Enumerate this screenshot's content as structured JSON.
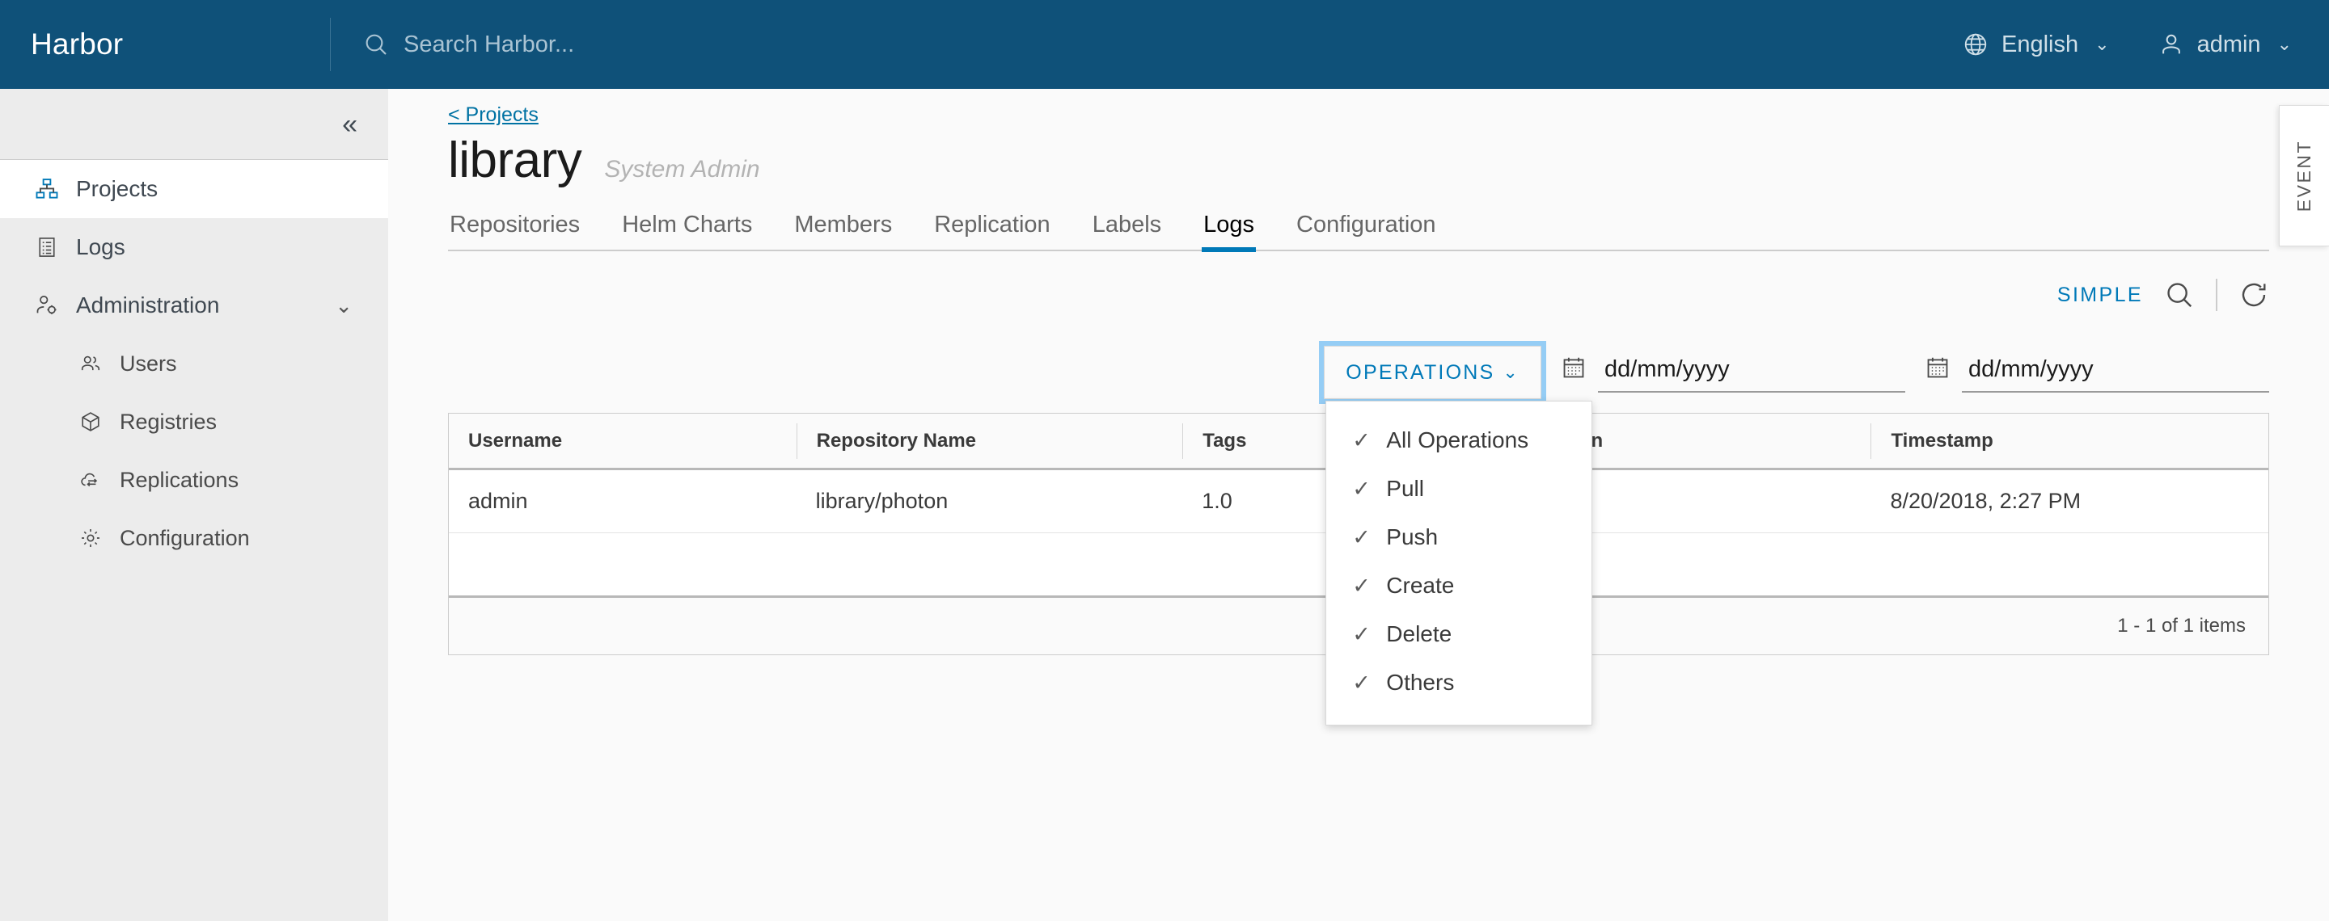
{
  "header": {
    "brand": "Harbor",
    "search_placeholder": "Search Harbor...",
    "language": "English",
    "user": "admin"
  },
  "sidebar": {
    "collapse_label": "«",
    "items": [
      {
        "label": "Projects",
        "icon": "org-chart-icon",
        "active": true
      },
      {
        "label": "Logs",
        "icon": "list-document-icon",
        "active": false
      },
      {
        "label": "Administration",
        "icon": "user-gear-icon",
        "active": false,
        "expandable": true
      }
    ],
    "sub_items": [
      {
        "label": "Users",
        "icon": "users-icon"
      },
      {
        "label": "Registries",
        "icon": "cube-icon"
      },
      {
        "label": "Replications",
        "icon": "cloud-sync-icon"
      },
      {
        "label": "Configuration",
        "icon": "gear-icon"
      }
    ]
  },
  "page": {
    "breadcrumb": "< Projects",
    "title": "library",
    "role": "System Admin",
    "tabs": [
      {
        "label": "Repositories",
        "active": false
      },
      {
        "label": "Helm Charts",
        "active": false
      },
      {
        "label": "Members",
        "active": false
      },
      {
        "label": "Replication",
        "active": false
      },
      {
        "label": "Labels",
        "active": false
      },
      {
        "label": "Logs",
        "active": true
      },
      {
        "label": "Configuration",
        "active": false
      }
    ]
  },
  "toolbar": {
    "simple_label": "SIMPLE",
    "search_icon": "search-icon",
    "refresh_icon": "refresh-icon"
  },
  "filters": {
    "operations_label": "OPERATIONS",
    "date_from_placeholder": "dd/mm/yyyy",
    "date_from_value": "",
    "date_to_placeholder": "dd/mm/yyyy",
    "date_to_value": "",
    "dropdown_open": true,
    "dropdown_items": [
      {
        "label": "All Operations",
        "checked": true
      },
      {
        "label": "Pull",
        "checked": true
      },
      {
        "label": "Push",
        "checked": true
      },
      {
        "label": "Create",
        "checked": true
      },
      {
        "label": "Delete",
        "checked": true
      },
      {
        "label": "Others",
        "checked": true
      }
    ]
  },
  "table": {
    "columns": [
      "Username",
      "Repository Name",
      "Tags",
      "Operation",
      "Timestamp"
    ],
    "rows": [
      {
        "username": "admin",
        "repository_name": "library/photon",
        "tags": "1.0",
        "operation": "",
        "timestamp": "8/20/2018, 2:27 PM"
      }
    ],
    "pagination": "1 - 1 of 1 items"
  },
  "side_panel": {
    "event_label": "EVENT"
  },
  "colors": {
    "header_bg": "#0f5179",
    "accent_blue": "#0079b8",
    "link_blue": "#0072a3",
    "sidebar_bg": "#ececec",
    "content_bg": "#fafafa",
    "focus_ring": "#95cdf5"
  }
}
